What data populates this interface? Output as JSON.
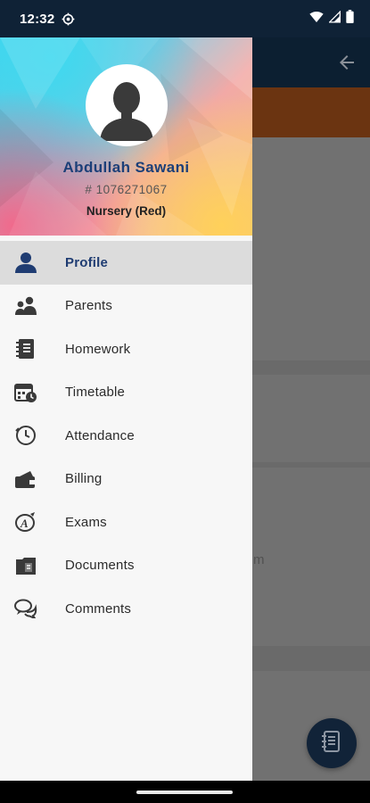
{
  "status_bar": {
    "time": "12:32",
    "icons": [
      "settings-gear-icon",
      "wifi-icon",
      "signal-icon",
      "battery-icon"
    ]
  },
  "profile": {
    "name": "Abdullah Sawani",
    "id": "# 1076271067",
    "class": "Nursery (Red)"
  },
  "menu": {
    "items": [
      {
        "label": "Profile",
        "icon": "person-icon",
        "active": true
      },
      {
        "label": "Parents",
        "icon": "people-icon"
      },
      {
        "label": "Homework",
        "icon": "notebook-icon"
      },
      {
        "label": "Timetable",
        "icon": "calendar-icon"
      },
      {
        "label": "Attendance",
        "icon": "clock-icon"
      },
      {
        "label": "Billing",
        "icon": "wallet-icon"
      },
      {
        "label": "Exams",
        "icon": "exam-icon"
      },
      {
        "label": "Documents",
        "icon": "document-icon"
      },
      {
        "label": "Comments",
        "icon": "comments-icon"
      }
    ]
  },
  "background_app": {
    "back_icon": "arrow-back-icon",
    "fab_icon": "notebook-icon",
    "partial_text": "m"
  },
  "colors": {
    "status_bar": "#0f2236",
    "accent_text": "#1c3f78",
    "active_item_bg": "#dcdcdc",
    "drawer_bg": "#f7f7f7",
    "icon": "#3a3a3a",
    "active_icon": "#1f3c72"
  }
}
